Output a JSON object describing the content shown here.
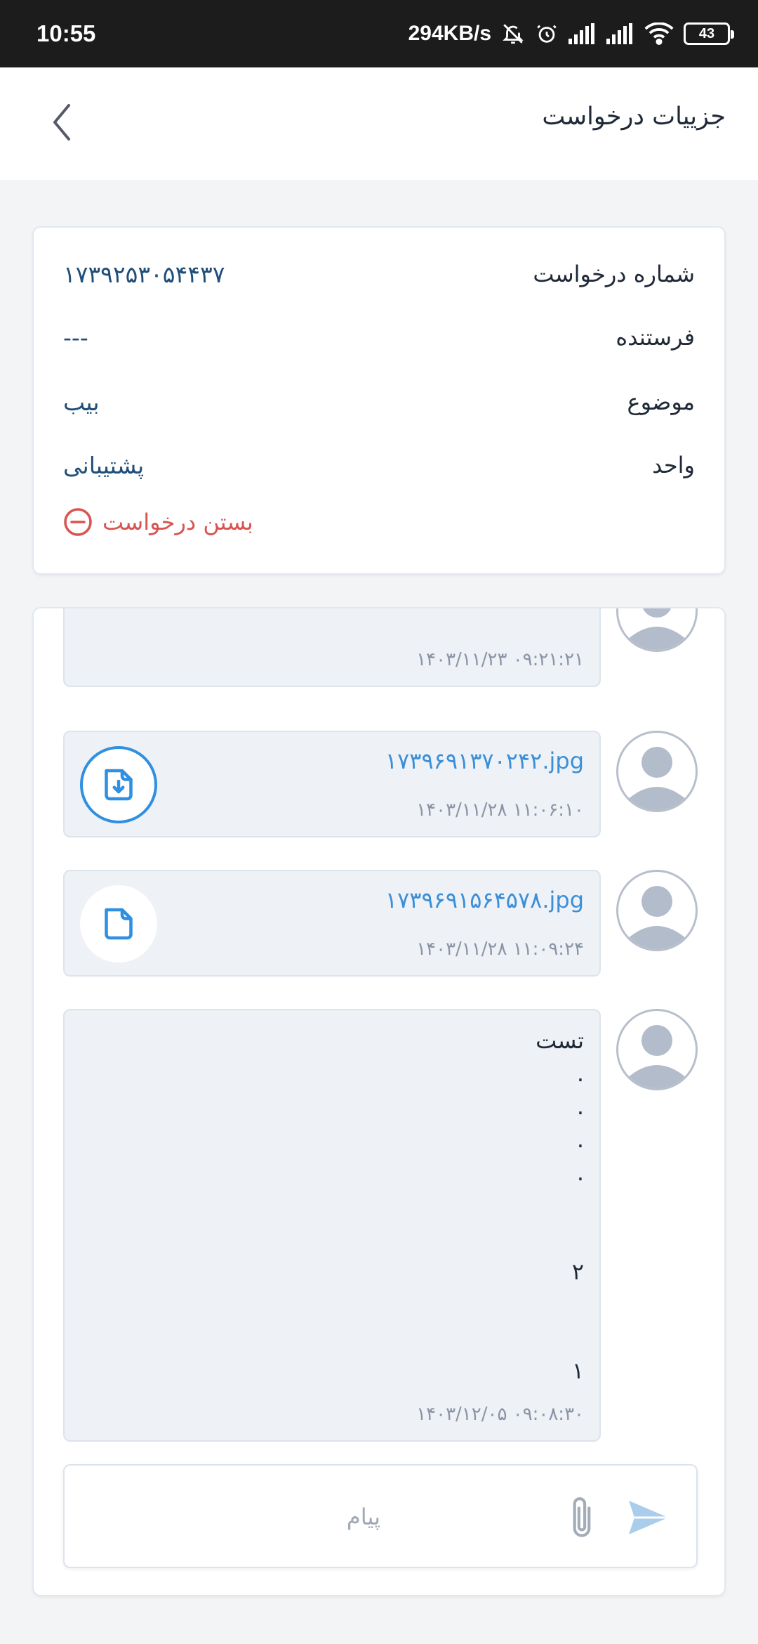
{
  "status_bar": {
    "time": "10:55",
    "speed": "294KB/s",
    "battery": "43"
  },
  "header": {
    "title": "جزییات درخواست",
    "back_icon": "chevron-left-icon"
  },
  "info": {
    "request_number_label": "شماره درخواست",
    "request_number_value": "۱۷۳۹۲۵۳۰۵۴۴۳۷",
    "sender_label": "فرستنده",
    "sender_value": "---",
    "subject_label": "موضوع",
    "subject_value": "بیب",
    "unit_label": "واحد",
    "unit_value": "پشتیبانی",
    "close_label": "بستن درخواست",
    "close_icon": "minus-circle-icon",
    "close_color": "#d9534f"
  },
  "messages": [
    {
      "type": "partial",
      "time": "۱۴۰۳/۱۱/۲۳ ۰۹:۲۱:۲۱"
    },
    {
      "type": "file",
      "file_name": "۱۷۳۹۶۹۱۳۷۰۲۴۲.jpg",
      "time": "۱۴۰۳/۱۱/۲۸ ۱۱:۰۶:۱۰",
      "icon": "file-download-icon"
    },
    {
      "type": "file",
      "file_name": "۱۷۳۹۶۹۱۵۶۴۵۷۸.jpg",
      "time": "۱۴۰۳/۱۱/۲۸ ۱۱:۰۹:۲۴",
      "icon": "file-icon"
    },
    {
      "type": "text",
      "lines": [
        "تست",
        ".",
        ".",
        ".",
        ".",
        "",
        "",
        "۲",
        "",
        "",
        "۱"
      ],
      "time": "۱۴۰۳/۱۲/۰۵ ۰۹:۰۸:۳۰"
    }
  ],
  "composer": {
    "placeholder": "پیام",
    "attach_icon": "paperclip-icon",
    "send_icon": "send-icon"
  },
  "colors": {
    "accent": "#3a8fd8",
    "value_text": "#1f4e79",
    "bubble_bg": "#eef1f5"
  }
}
